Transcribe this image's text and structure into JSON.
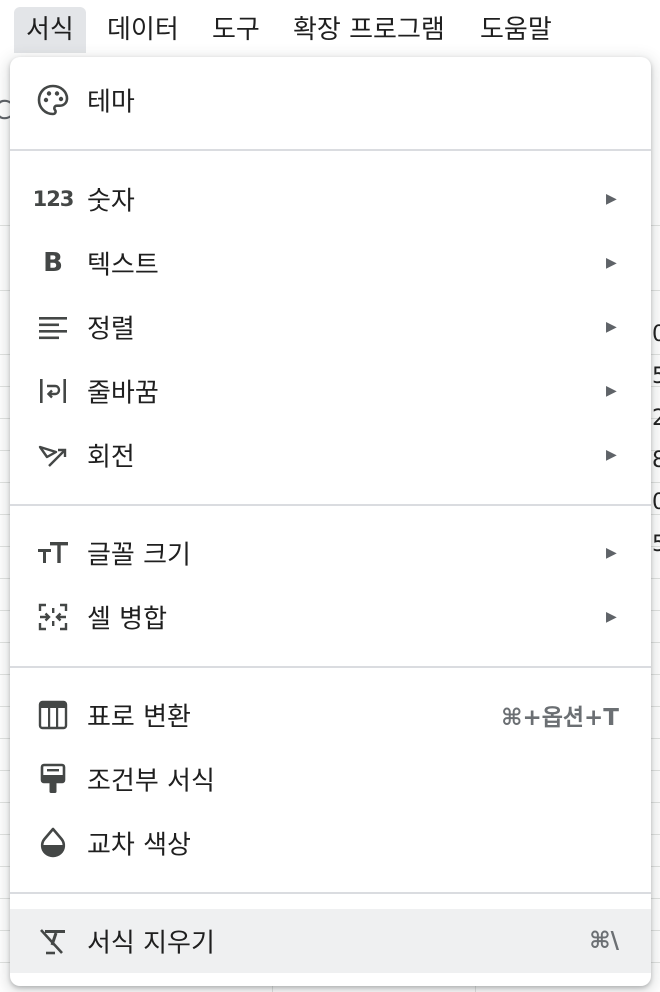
{
  "menubar": {
    "items": [
      {
        "label": "서식",
        "active": true
      },
      {
        "label": "데이터"
      },
      {
        "label": "도구"
      },
      {
        "label": "확장 프로그램"
      },
      {
        "label": "도움말"
      }
    ]
  },
  "menu": {
    "items": [
      {
        "icon": "palette-icon",
        "label": "테마"
      },
      {
        "icon": "number-format-icon",
        "icon_text": "123",
        "label": "숫자",
        "submenu": true
      },
      {
        "icon": "bold-icon",
        "icon_text": "B",
        "label": "텍스트",
        "submenu": true
      },
      {
        "icon": "align-left-icon",
        "label": "정렬",
        "submenu": true
      },
      {
        "icon": "text-wrap-icon",
        "label": "줄바꿈",
        "submenu": true
      },
      {
        "icon": "text-rotation-icon",
        "label": "회전",
        "submenu": true
      },
      {
        "icon": "font-size-icon",
        "label": "글꼴 크기",
        "submenu": true
      },
      {
        "icon": "merge-cells-icon",
        "label": "셀 병합",
        "submenu": true
      },
      {
        "icon": "table-icon",
        "label": "표로 변환",
        "shortcut": "⌘+옵션+T"
      },
      {
        "icon": "paint-roller-icon",
        "label": "조건부 서식"
      },
      {
        "icon": "color-drop-icon",
        "label": "교차 색상"
      },
      {
        "icon": "clear-format-icon",
        "label": "서식 지우기",
        "shortcut": "⌘\\",
        "highlighted": true
      }
    ],
    "submenu_arrow": "▶"
  },
  "sheet": {
    "right_edge_peek": [
      "0",
      "5",
      "2",
      "8",
      "0",
      "5"
    ],
    "left_edge_peek": "C"
  },
  "colors": {
    "menu_bg": "#ffffff",
    "active_menubar_bg": "#e3e5e8",
    "highlight_bg": "#eff0f1",
    "separator": "#dadce0",
    "text": "#1f1f1f",
    "icon": "#444746"
  }
}
